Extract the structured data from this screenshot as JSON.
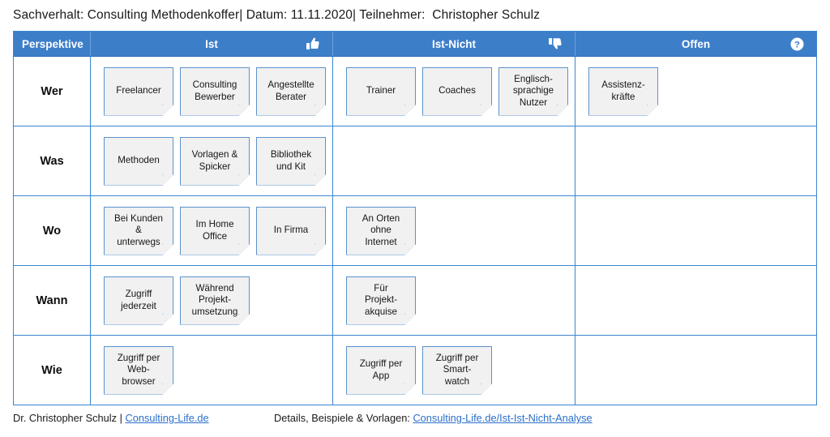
{
  "title": {
    "full": "Sachverhalt: Consulting Methodenkoffer| Datum: 11.11.2020| Teilnehmer:  Christopher Schulz"
  },
  "table": {
    "columns": [
      {
        "label": "Perspektive",
        "icon": ""
      },
      {
        "label": "Ist",
        "icon": "thumbs-up-icon"
      },
      {
        "label": "Ist-Nicht",
        "icon": "thumbs-down-icon"
      },
      {
        "label": "Offen",
        "icon": "question-mark-circle-icon"
      }
    ],
    "rows": [
      {
        "perspective": "Wer",
        "ist": [
          "Freelancer",
          "Consulting\nBewerber",
          "Angestellte\nBerater"
        ],
        "ist_nicht": [
          "Trainer",
          "Coaches",
          "Englisch-\nsprachige\nNutzer"
        ],
        "offen": [
          "Assistenz-\nkräfte"
        ]
      },
      {
        "perspective": "Was",
        "ist": [
          "Methoden",
          "Vorlagen &\nSpicker",
          "Bibliothek\nund Kit"
        ],
        "ist_nicht": [],
        "offen": []
      },
      {
        "perspective": "Wo",
        "ist": [
          "Bei Kunden\n&\nunterwegs",
          "Im Home\nOffice",
          "In Firma"
        ],
        "ist_nicht": [
          "An Orten\nohne\nInternet"
        ],
        "offen": []
      },
      {
        "perspective": "Wann",
        "ist": [
          "Zugriff\njederzeit",
          "Während\nProjekt-\numsetzung"
        ],
        "ist_nicht": [
          "Für\nProjekt-\nakquise"
        ],
        "offen": []
      },
      {
        "perspective": "Wie",
        "ist": [
          "Zugriff per\nWeb-\nbrowser"
        ],
        "ist_nicht": [
          "Zugriff per\nApp",
          "Zugriff per\nSmart-\nwatch"
        ],
        "offen": []
      }
    ]
  },
  "footer": {
    "author_prefix": "Dr. Christopher Schulz | ",
    "author_link": "Consulting-Life.de",
    "details_prefix": "Details, Beispiele & Vorlagen: ",
    "details_link": "Consulting-Life.de/Ist-Ist-Nicht-Analyse"
  },
  "colors": {
    "header_blue": "#3d7ec9",
    "border_blue": "#3b86cf",
    "note_bg": "#f1f1f1",
    "note_border": "#5b93cc",
    "link": "#2a6fc9"
  }
}
